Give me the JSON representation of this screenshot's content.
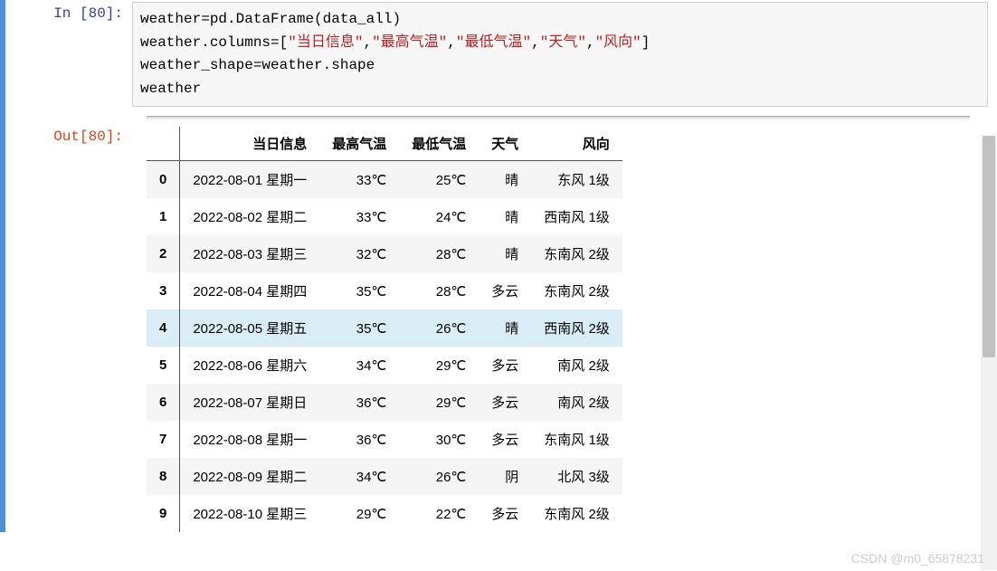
{
  "input": {
    "prompt": "In [80]:",
    "lines": {
      "l1_a": "weather",
      "l1_b": "=",
      "l1_c": "pd.DataFrame(data_all)",
      "l2_a": "weather.columns",
      "l2_b": "=",
      "l2_c": "[",
      "l2_d": "\"当日信息\"",
      "l2_e": ",",
      "l2_f": "\"最高气温\"",
      "l2_g": ",",
      "l2_h": "\"最低气温\"",
      "l2_i": ",",
      "l2_j": "\"天气\"",
      "l2_k": ",",
      "l2_l": "\"风向\"",
      "l2_m": "]",
      "l3": "weather_shape=weather.shape",
      "l4": "weather"
    }
  },
  "output": {
    "prompt": "Out[80]:",
    "columns": [
      "当日信息",
      "最高气温",
      "最低气温",
      "天气",
      "风向"
    ],
    "rows": [
      {
        "idx": "0",
        "c0": "2022-08-01 星期一",
        "c1": "33℃",
        "c2": "25℃",
        "c3": "晴",
        "c4": "东风 1级"
      },
      {
        "idx": "1",
        "c0": "2022-08-02 星期二",
        "c1": "33℃",
        "c2": "24℃",
        "c3": "晴",
        "c4": "西南风 1级"
      },
      {
        "idx": "2",
        "c0": "2022-08-03 星期三",
        "c1": "32℃",
        "c2": "28℃",
        "c3": "晴",
        "c4": "东南风 2级"
      },
      {
        "idx": "3",
        "c0": "2022-08-04 星期四",
        "c1": "35℃",
        "c2": "28℃",
        "c3": "多云",
        "c4": "东南风 2级"
      },
      {
        "idx": "4",
        "c0": "2022-08-05 星期五",
        "c1": "35℃",
        "c2": "26℃",
        "c3": "晴",
        "c4": "西南风 2级"
      },
      {
        "idx": "5",
        "c0": "2022-08-06 星期六",
        "c1": "34℃",
        "c2": "29℃",
        "c3": "多云",
        "c4": "南风 2级"
      },
      {
        "idx": "6",
        "c0": "2022-08-07 星期日",
        "c1": "36℃",
        "c2": "29℃",
        "c3": "多云",
        "c4": "南风 2级"
      },
      {
        "idx": "7",
        "c0": "2022-08-08 星期一",
        "c1": "36℃",
        "c2": "30℃",
        "c3": "多云",
        "c4": "东南风 1级"
      },
      {
        "idx": "8",
        "c0": "2022-08-09 星期二",
        "c1": "34℃",
        "c2": "26℃",
        "c3": "阴",
        "c4": "北风 3级"
      },
      {
        "idx": "9",
        "c0": "2022-08-10 星期三",
        "c1": "29℃",
        "c2": "22℃",
        "c3": "多云",
        "c4": "东南风 2级"
      }
    ],
    "highlight_idx": "4"
  },
  "watermark": "CSDN @m0_65878231"
}
